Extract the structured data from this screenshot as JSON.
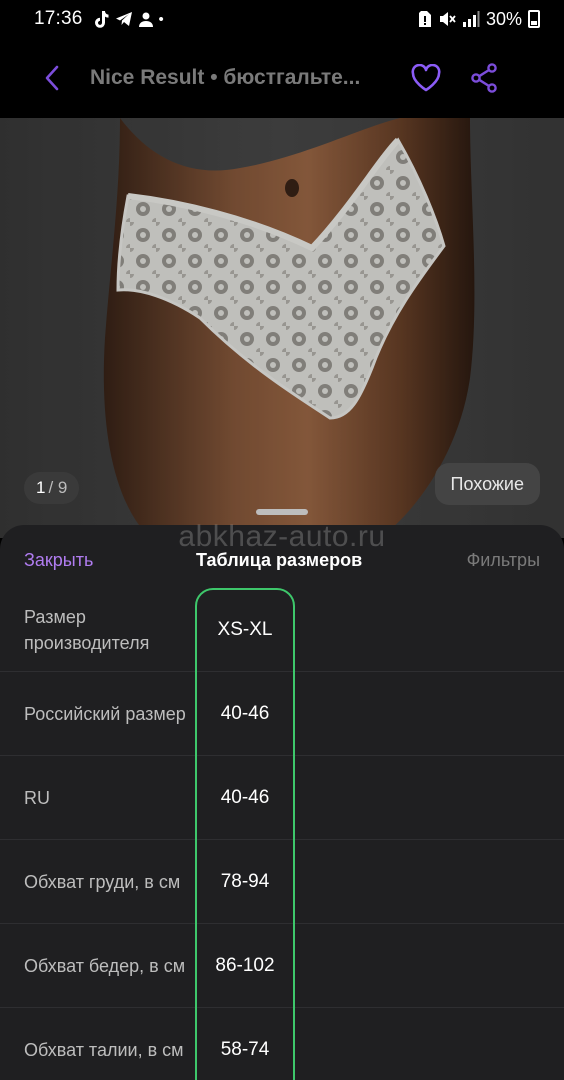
{
  "status_bar": {
    "time": "17:36",
    "battery": "30%",
    "left_icons": [
      "tiktok-icon",
      "telegram-icon",
      "person-icon",
      "dot-icon"
    ],
    "right_icons": [
      "sim-alert-icon",
      "mute-icon",
      "signal-icon",
      "battery-icon"
    ]
  },
  "header": {
    "title": "Nice Result • бюстгальте...",
    "accent_color": "#8b5cf6"
  },
  "gallery": {
    "current": "1",
    "total": "/ 9",
    "similar_label": "Похожие"
  },
  "watermark": "abkhaz-auto.ru",
  "sheet": {
    "close_label": "Закрыть",
    "title": "Таблица размеров",
    "filters_label": "Фильтры",
    "highlight_color": "#3ec76b",
    "rows": [
      {
        "label": "Размер производителя",
        "value": "XS-XL"
      },
      {
        "label": "Российский размер",
        "value": "40-46"
      },
      {
        "label": "RU",
        "value": "40-46"
      },
      {
        "label": "Обхват груди, в см",
        "value": "78-94"
      },
      {
        "label": "Обхват бедер, в см",
        "value": "86-102"
      },
      {
        "label": "Обхват талии, в см",
        "value": "58-74"
      }
    ]
  }
}
